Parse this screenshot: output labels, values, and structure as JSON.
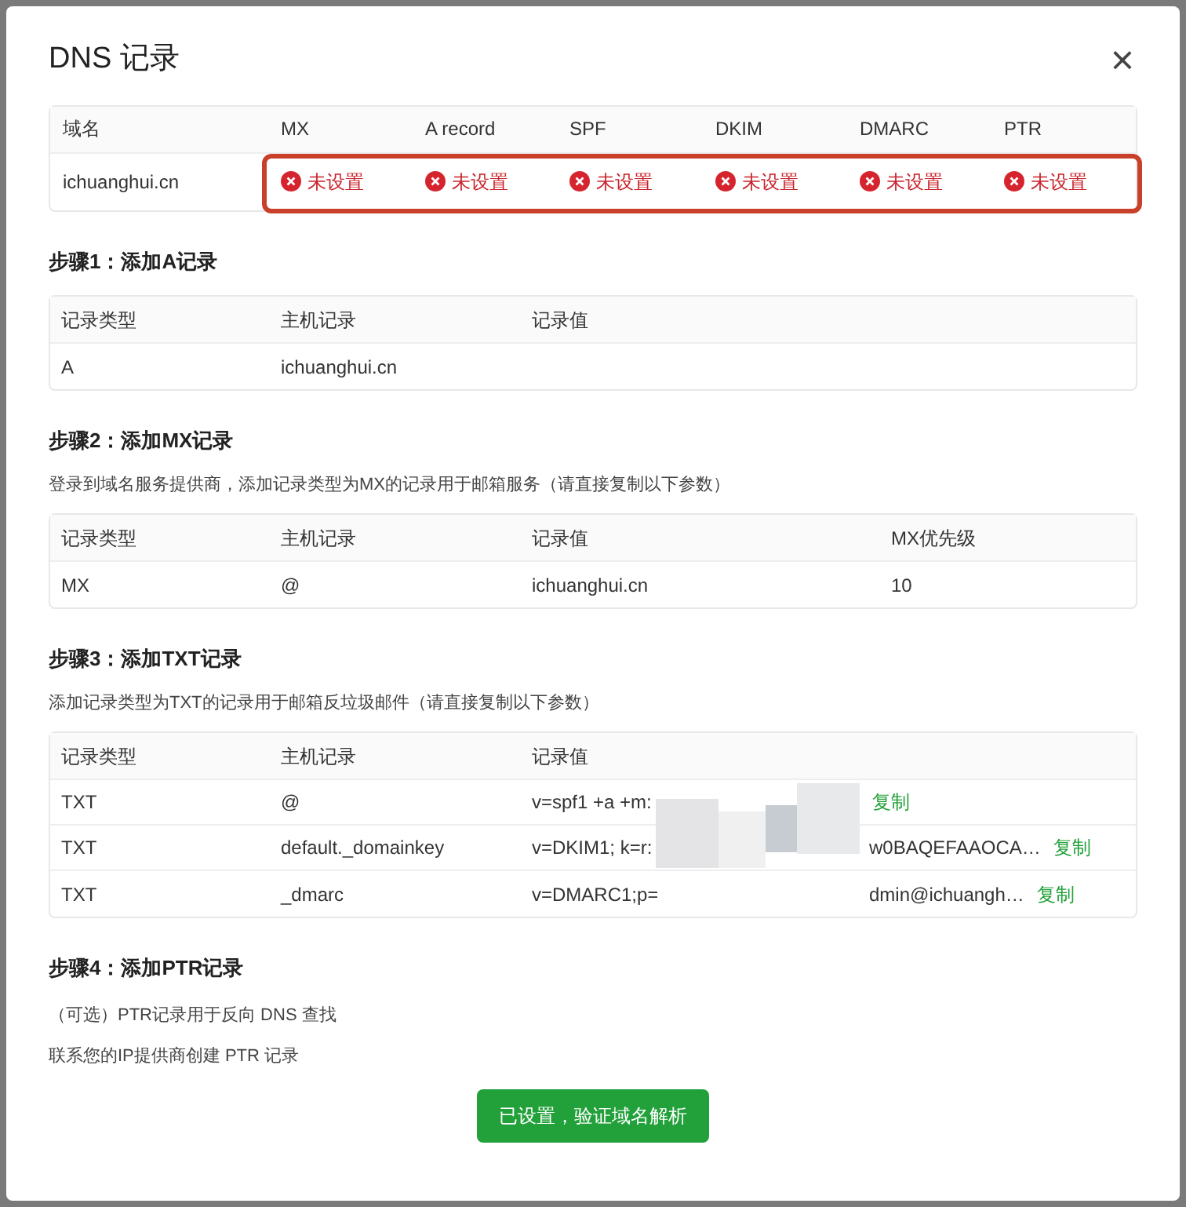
{
  "dialog": {
    "title": "DNS 记录",
    "close": "×"
  },
  "overview": {
    "columns": [
      "域名",
      "MX",
      "A record",
      "SPF",
      "DKIM",
      "DMARC",
      "PTR"
    ],
    "domain": "ichuanghui.cn",
    "statuses": [
      {
        "label": "未设置",
        "set": false
      },
      {
        "label": "未设置",
        "set": false
      },
      {
        "label": "未设置",
        "set": false
      },
      {
        "label": "未设置",
        "set": false
      },
      {
        "label": "未设置",
        "set": false
      },
      {
        "label": "未设置",
        "set": false
      }
    ],
    "highlighted": true
  },
  "steps": [
    {
      "title": "步骤1：添加A记录",
      "columns": [
        "记录类型",
        "主机记录",
        "记录值"
      ],
      "rows": [
        {
          "cells": [
            "A",
            "ichuanghui.cn",
            ""
          ]
        }
      ]
    },
    {
      "title": "步骤2：添加MX记录",
      "description": "登录到域名服务提供商，添加记录类型为MX的记录用于邮箱服务（请直接复制以下参数）",
      "columns": [
        "记录类型",
        "主机记录",
        "记录值",
        "MX优先级"
      ],
      "rows": [
        {
          "cells": [
            "MX",
            "@",
            "ichuanghui.cn",
            "10"
          ]
        }
      ]
    },
    {
      "title": "步骤3：添加TXT记录",
      "description": "添加记录类型为TXT的记录用于邮箱反垃圾邮件（请直接复制以下参数）",
      "columns": [
        "记录类型",
        "主机记录",
        "记录值"
      ],
      "redacted": true,
      "rows": [
        {
          "cells": [
            "TXT",
            "@",
            "v=spf1 +a +m:"
          ],
          "tail": "",
          "copy": "复制"
        },
        {
          "cells": [
            "TXT",
            "default._domainkey",
            "v=DKIM1; k=r:"
          ],
          "tail": "w0BAQEFAAOCA…",
          "copy": "复制"
        },
        {
          "cells": [
            "TXT",
            "_dmarc",
            "v=DMARC1;p="
          ],
          "tail": "dmin@ichuangh…",
          "copy": "复制"
        }
      ]
    },
    {
      "title": "步骤4：添加PTR记录",
      "notes": [
        "（可选）PTR记录用于反向 DNS 查找",
        "联系您的IP提供商创建 PTR 记录"
      ]
    }
  ],
  "button": "已设置，验证域名解析"
}
